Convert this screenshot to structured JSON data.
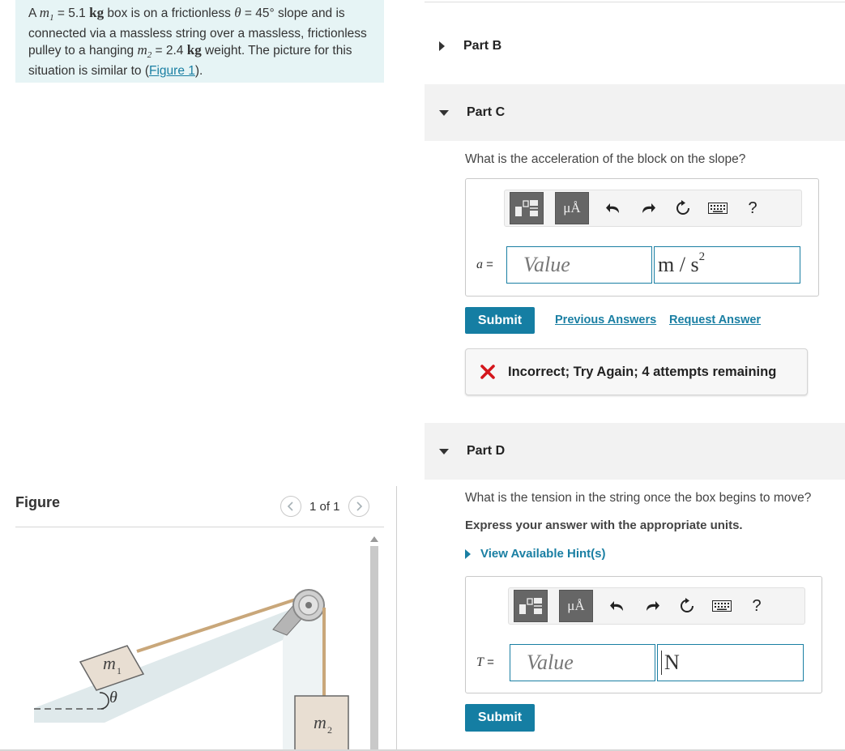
{
  "problem": {
    "text_1": "A ",
    "m1_symbol": "m",
    "m1_sub": "1",
    "text_2": " = 5.1 ",
    "unit_kg_1": "kg",
    "text_3": " box is on a frictionless ",
    "theta_symbol": "θ",
    "text_4": " = 45° slope and is connected via a massless string over a massless, frictionless pulley to a hanging ",
    "m2_symbol": "m",
    "m2_sub": "2",
    "text_5": " = 2.4 ",
    "unit_kg_2": "kg",
    "text_6": " weight. The picture for this situation is similar to (",
    "figure_link": "Figure 1",
    "text_7": ")."
  },
  "figure": {
    "title": "Figure",
    "page_indicator": "1 of 1",
    "label_m1": "m",
    "label_m1_sub": "1",
    "label_m2": "m",
    "label_m2_sub": "2",
    "label_theta": "θ"
  },
  "part_b": {
    "label": "Part B"
  },
  "part_c": {
    "label": "Part C",
    "question": "What is the acceleration of the block on the slope?",
    "variable": "a",
    "equals": " =",
    "value_placeholder": "Value",
    "unit": "m / s",
    "unit_exponent": "2",
    "submit": "Submit",
    "previous_answers": "Previous Answers",
    "request_answer": "Request Answer",
    "feedback": "Incorrect; Try Again; 4 attempts remaining"
  },
  "part_d": {
    "label": "Part D",
    "question": "What is the tension in the string once the box begins to move?",
    "instruction": "Express your answer with the appropriate units.",
    "hint": "View Available Hint(s)",
    "variable": "T",
    "equals": " =",
    "value_placeholder": "Value",
    "unit": "N",
    "submit": "Submit"
  },
  "toolbar": {
    "mu_label": "μÅ",
    "help_label": "?"
  },
  "colors": {
    "accent": "#157ea3",
    "problem_bg": "#e6f4f5",
    "part_header_bg": "#f2f2f2",
    "error": "#d4161c"
  }
}
